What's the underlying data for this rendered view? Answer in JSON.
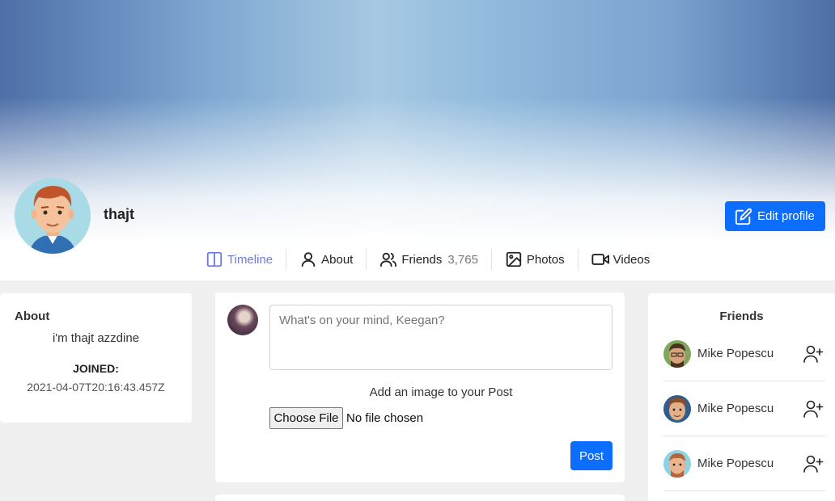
{
  "profile": {
    "username": "thajt",
    "edit_label": "Edit profile"
  },
  "tabs": [
    {
      "label": "Timeline",
      "count": ""
    },
    {
      "label": "About",
      "count": ""
    },
    {
      "label": "Friends",
      "count": "3,765"
    },
    {
      "label": "Photos",
      "count": ""
    },
    {
      "label": "Videos",
      "count": ""
    }
  ],
  "about": {
    "title": "About",
    "bio": "i'm thajt azzdine",
    "joined_label": "JOINED:",
    "joined_date": "2021-04-07T20:16:43.457Z"
  },
  "composer": {
    "placeholder": "What's on your mind, Keegan?",
    "image_label": "Add an image to your Post",
    "file_button": "Choose File",
    "file_status": "No file chosen",
    "post_label": "Post"
  },
  "friends": {
    "title": "Friends",
    "items": [
      {
        "name": "Mike Popescu"
      },
      {
        "name": "Mike Popescu"
      },
      {
        "name": "Mike Popescu"
      }
    ]
  },
  "colors": {
    "accent": "#0d6efd",
    "active_tab": "#6c7ae0"
  }
}
